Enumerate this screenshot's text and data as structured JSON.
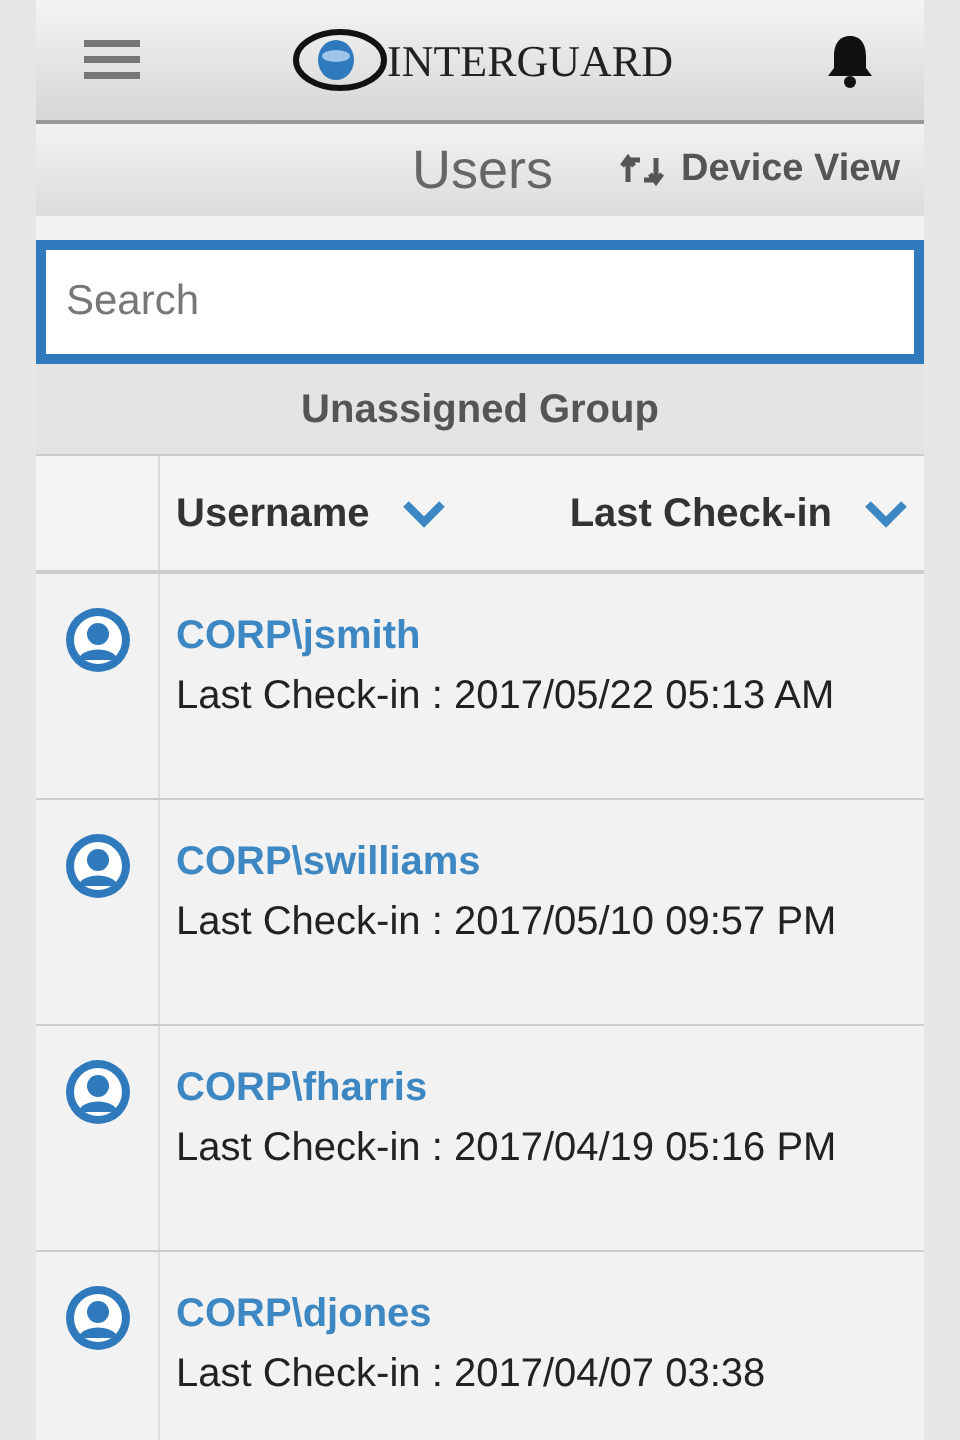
{
  "header": {
    "logo": "INTERGUARD"
  },
  "title_bar": {
    "title": "Users",
    "switch_label": "Device View"
  },
  "search": {
    "placeholder": "Search"
  },
  "group": {
    "title": "Unassigned Group"
  },
  "table": {
    "columns": [
      "Username",
      "Last Check-in"
    ],
    "rows": [
      {
        "username": "CORP\\jsmith",
        "checkin": "Last Check-in : 2017/05/22 05:13 AM"
      },
      {
        "username": "CORP\\swilliams",
        "checkin": "Last Check-in : 2017/05/10 09:57 PM"
      },
      {
        "username": "CORP\\fharris",
        "checkin": "Last Check-in : 2017/04/19 05:16 PM"
      },
      {
        "username": "CORP\\djones",
        "checkin": "Last Check-in : 2017/04/07 03:38"
      }
    ]
  }
}
